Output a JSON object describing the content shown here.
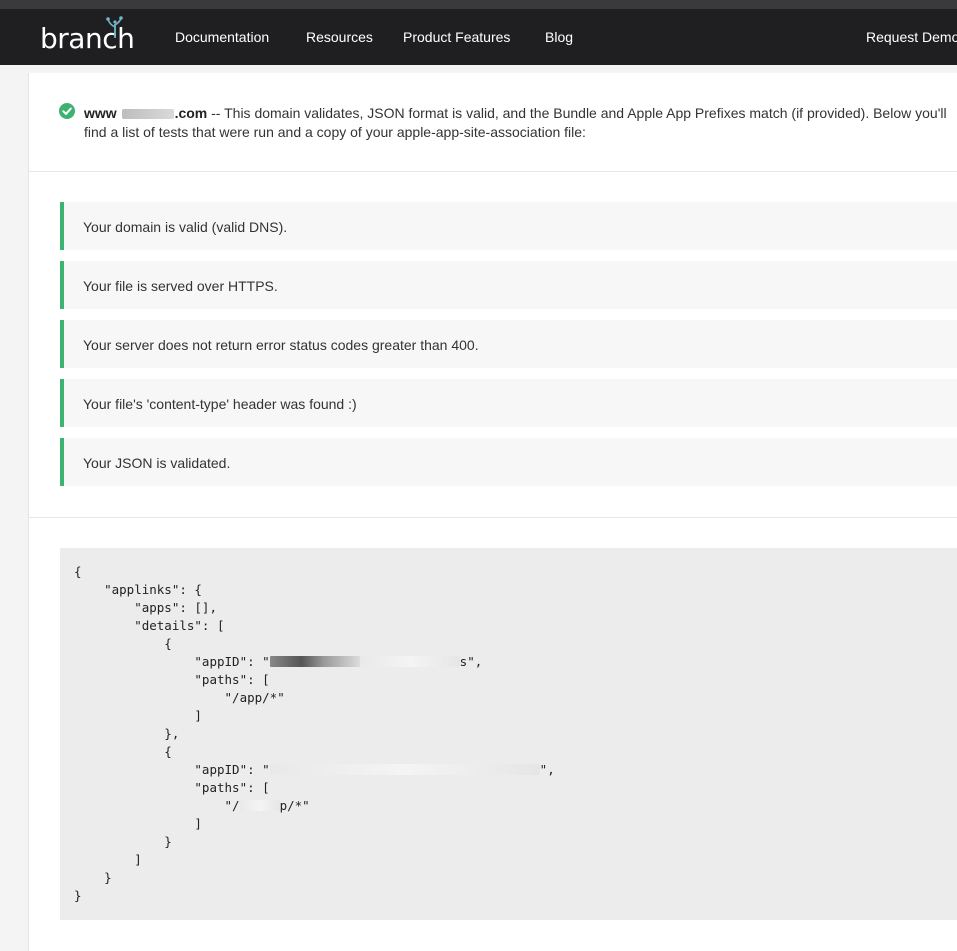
{
  "nav": {
    "logo": "branch",
    "items": [
      "Documentation",
      "Resources",
      "Product Features",
      "Blog"
    ],
    "cta": "Request Demo"
  },
  "summary": {
    "domain_prefix": "www",
    "domain_suffix": ".com",
    "message": " -- This domain validates, JSON format is valid, and the Bundle and Apple App Prefixes match (if provided). Below you'll find a list of tests that were run and a copy of your apple-app-site-association file:"
  },
  "tests": [
    "Your domain is valid (valid DNS).",
    "Your file is served over HTTPS.",
    "Your server does not return error status codes greater than 400.",
    "Your file's 'content-type' header was found :)",
    "Your JSON is validated."
  ],
  "json_file": {
    "line_01": "{",
    "line_02": "    \"applinks\": {",
    "line_03": "        \"apps\": [],",
    "line_04": "        \"details\": [",
    "line_05": "            {",
    "line_06a": "                \"appID\": \"",
    "line_06b": "s\",",
    "line_07": "                \"paths\": [",
    "line_08": "                    \"/app/*\"",
    "line_09": "                ]",
    "line_10": "            },",
    "line_11": "            {",
    "line_12a": "                \"appID\": \"",
    "line_12b": "\",",
    "line_13": "                \"paths\": [",
    "line_14a": "                    \"/",
    "line_14b": "p/*\"",
    "line_15": "                ]",
    "line_16": "            }",
    "line_17": "        ]",
    "line_18": "    }",
    "line_19": "}"
  },
  "colors": {
    "nav_bg": "#1f1f21",
    "success": "#3cb371",
    "code_bg": "#ececec"
  }
}
